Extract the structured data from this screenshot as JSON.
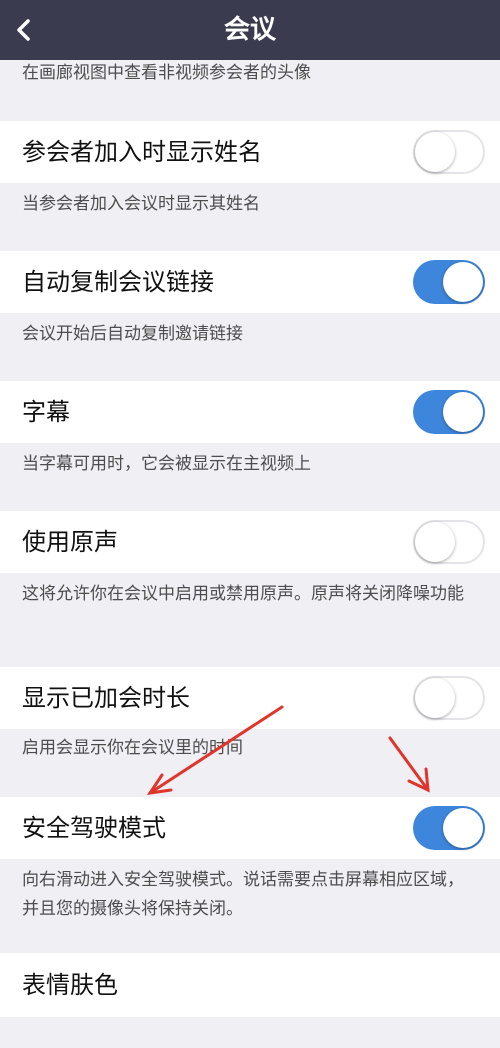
{
  "nav": {
    "title": "会议",
    "back_icon": "chevron-left-icon"
  },
  "colors": {
    "nav_bg": "#3a3b4e",
    "toggle_on": "#3d86dc",
    "annotation_arrow": "#e0352b"
  },
  "top_desc": "在画廊视图中查看非视频参会者的头像",
  "settings": [
    {
      "label": "参会者加入时显示姓名",
      "on": false,
      "desc": "当参会者加入会议时显示其姓名"
    },
    {
      "label": "自动复制会议链接",
      "on": true,
      "desc": "会议开始后自动复制邀请链接"
    },
    {
      "label": "字幕",
      "on": true,
      "desc": "当字幕可用时，它会被显示在主视频上"
    },
    {
      "label": "使用原声",
      "on": false,
      "desc": "这将允许你在会议中启用或禁用原声。原声将关闭降噪功能"
    },
    {
      "label": "显示已加会时长",
      "on": false,
      "desc": "启用会显示你在会议里的时间"
    },
    {
      "label": "安全驾驶模式",
      "on": true,
      "desc": "向右滑动进入安全驾驶模式。说话需要点击屏幕相应区域，并且您的摄像头将保持关闭。"
    },
    {
      "label": "表情肤色"
    }
  ]
}
